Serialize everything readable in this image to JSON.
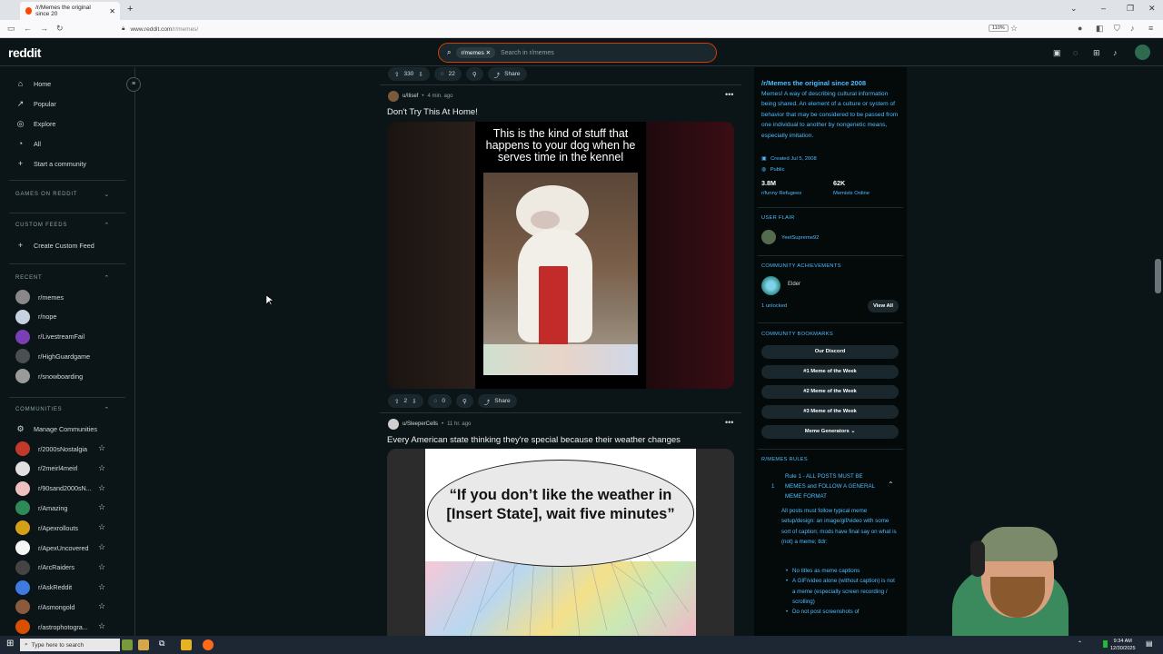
{
  "browser": {
    "tab_title": "/r/Memes the original since 20",
    "url_host": "www.reddit.com",
    "url_path": "/r/memes/",
    "zoom": "110%"
  },
  "header": {
    "logo": "reddit",
    "search_chip": "r/memes",
    "search_placeholder": "Search in r/memes"
  },
  "sidebar": {
    "nav": [
      {
        "label": "Home",
        "icon": "home-icon"
      },
      {
        "label": "Popular",
        "icon": "popular-icon"
      },
      {
        "label": "Explore",
        "icon": "explore-icon"
      },
      {
        "label": "All",
        "icon": "all-icon"
      },
      {
        "label": "Start a community",
        "icon": "plus-icon"
      }
    ],
    "games_header": "GAMES ON REDDIT",
    "custom_feeds_header": "CUSTOM FEEDS",
    "create_custom_feed": "Create Custom Feed",
    "recent_header": "RECENT",
    "recent": [
      {
        "label": "r/memes",
        "color": "#888888"
      },
      {
        "label": "r/nope",
        "color": "#c7d2e0"
      },
      {
        "label": "r/LivestreamFail",
        "color": "#7b3fb5"
      },
      {
        "label": "r/HighGuardgame",
        "color": "#4a4f52"
      },
      {
        "label": "r/snowboarding",
        "color": "#9a9a9a"
      }
    ],
    "communities_header": "COMMUNITIES",
    "manage_communities": "Manage Communities",
    "communities": [
      {
        "label": "r/2000sNostalgia",
        "color": "#c0392b"
      },
      {
        "label": "r/2meirl4meirl",
        "color": "#e0e0e0"
      },
      {
        "label": "r/90sand2000sN...",
        "color": "#f0c0c0"
      },
      {
        "label": "r/Amazing",
        "color": "#2e8b57"
      },
      {
        "label": "r/Apexrollouts",
        "color": "#d4a017"
      },
      {
        "label": "r/ApexUncovered",
        "color": "#f5f5f5"
      },
      {
        "label": "r/ArcRaiders",
        "color": "#444444"
      },
      {
        "label": "r/AskReddit",
        "color": "#3d7be0"
      },
      {
        "label": "r/Asmongold",
        "color": "#8a5a3c"
      },
      {
        "label": "r/astrophotogra...",
        "color": "#d94f00"
      }
    ]
  },
  "feed": {
    "prev_post": {
      "upvotes": "330",
      "comments": "22",
      "share": "Share"
    },
    "post1": {
      "user": "u/Ilisef",
      "time": "4 min. ago",
      "title": "Don't Try This At Home!",
      "image_caption": "This is the kind of stuff that happens to your dog when he serves time in the kennel",
      "upvotes": "2",
      "comments": "0",
      "share": "Share"
    },
    "post2": {
      "user": "u/SleeperCells",
      "time": "11 hr. ago",
      "title": "Every American state thinking they're special because their weather changes",
      "image_quote": "“If you don’t like the weather in [Insert State], wait five minutes”"
    }
  },
  "right_panel": {
    "name": "/r/Memes the original since 2008",
    "description": "Memes! A way of describing cultural information being shared. An element of a culture or system of behavior that may be considered to be passed from one individual to another by nongenetic means, especially imitation.",
    "created": "Created Jul 5, 2008",
    "visibility": "Public",
    "members_count": "3.8M",
    "members_label": "r/funny Refugees",
    "online_count": "62K",
    "online_label": "Memists Online",
    "user_flair_header": "USER FLAIR",
    "user_flair_name": "YeetSupreme92",
    "achievements_header": "COMMUNITY ACHIEVEMENTS",
    "achievement_name": "Elder",
    "unlocked": "1 unlocked",
    "view_all": "View All",
    "bookmarks_header": "COMMUNITY BOOKMARKS",
    "bookmarks": [
      "Our Discord",
      "#1 Meme of the Week",
      "#2 Meme of the Week",
      "#3 Meme of the Week",
      "Meme Generators"
    ],
    "rules_header": "R/MEMES RULES",
    "rule1_number": "1",
    "rule1_title": "Rule 1 - ALL POSTS MUST BE MEMES and FOLLOW A GENERAL MEME FORMAT",
    "rule1_body": "All posts must follow typical meme setup/design: an image/gif/video with some sort of caption; mods have final say on what is (not) a meme; tldr:",
    "rule1_bullets": [
      "No titles as meme captions",
      "A GIF/video alone (without caption) is not a meme (especially screen recording / scrolling)",
      "Do not post screenshots of"
    ]
  },
  "taskbar": {
    "search_placeholder": "Type here to search",
    "time": "9:34 AM",
    "date": "12/30/2025"
  }
}
